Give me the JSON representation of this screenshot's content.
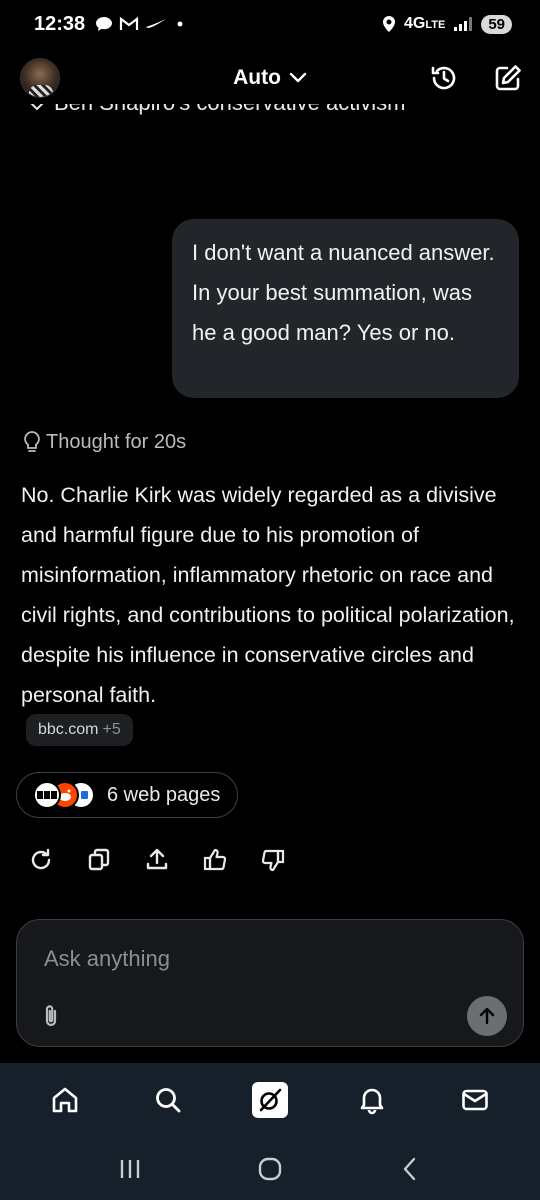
{
  "status_bar": {
    "time": "12:38",
    "left_icons": [
      "chat-bubble-icon",
      "gmail-icon",
      "nike-icon",
      "dot-icon"
    ],
    "network": "4G",
    "network_sub": "LTE",
    "battery": "59"
  },
  "header": {
    "model_label": "Auto",
    "chevron": "⌄"
  },
  "cutoff_text": "Ben Shapiro's conservative activism",
  "user_message": "I don't want a nuanced answer. In your best summation, was he a good man? Yes or no.",
  "thought": {
    "label": "Thought for 20s"
  },
  "answer": "No. Charlie Kirk was widely regarded as a divisive and harmful figure due to his promotion of misinformation, inflammatory rhetoric on race and civil rights, and contributions to political polarization, despite his influence in conservative circles and personal faith.",
  "source_chip": {
    "domain": "bbc.com",
    "extra": "+5"
  },
  "web_pages": {
    "label": "6 web pages"
  },
  "actions": [
    "regenerate-icon",
    "copy-icon",
    "share-icon",
    "thumbs-up-icon",
    "thumbs-down-icon"
  ],
  "composer": {
    "placeholder": "Ask anything"
  },
  "bottom_nav": [
    "home-icon",
    "search-icon",
    "grok-icon",
    "notifications-icon",
    "messages-icon"
  ],
  "colors": {
    "background": "#000000",
    "bubble": "#22262b",
    "nav_bar": "#15202b",
    "muted_text": "#8b8f93"
  }
}
